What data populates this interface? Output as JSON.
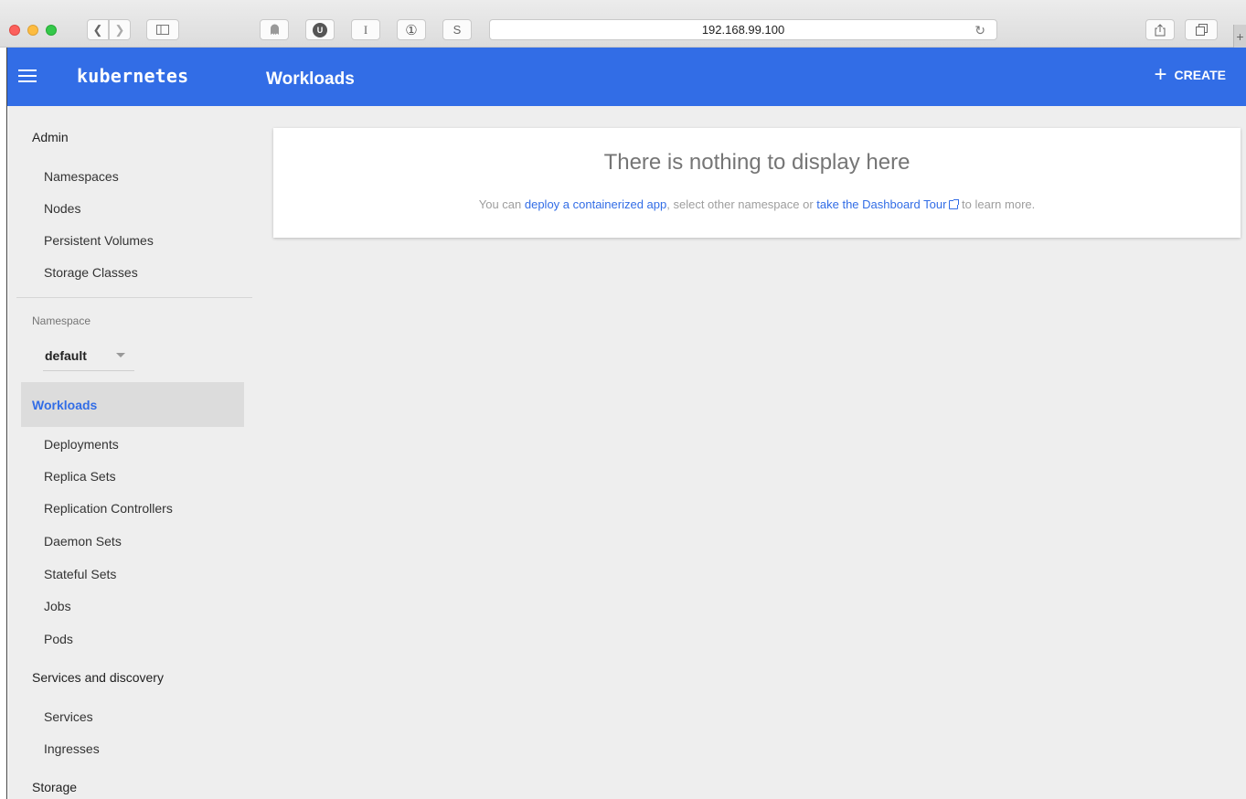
{
  "browser": {
    "url": "192.168.99.100",
    "ext_u": "U",
    "ext_i": "I",
    "ext_1p": "①",
    "ext_s": "S"
  },
  "header": {
    "brand": "kubernetes",
    "title": "Workloads",
    "create_label": "CREATE",
    "accent": "#326de6"
  },
  "sidebar": {
    "admin_label": "Admin",
    "admin_items": [
      "Namespaces",
      "Nodes",
      "Persistent Volumes",
      "Storage Classes"
    ],
    "namespace_label": "Namespace",
    "namespace_value": "default",
    "workloads_label": "Workloads",
    "workloads_items": [
      "Deployments",
      "Replica Sets",
      "Replication Controllers",
      "Daemon Sets",
      "Stateful Sets",
      "Jobs",
      "Pods"
    ],
    "services_label": "Services and discovery",
    "services_items": [
      "Services",
      "Ingresses"
    ],
    "storage_label": "Storage"
  },
  "empty_state": {
    "title": "There is nothing to display here",
    "text_prefix": "You can ",
    "link_deploy": "deploy a containerized app",
    "text_middle": ", select other namespace or ",
    "link_tour": "take the Dashboard Tour",
    "text_suffix": " to learn more."
  }
}
